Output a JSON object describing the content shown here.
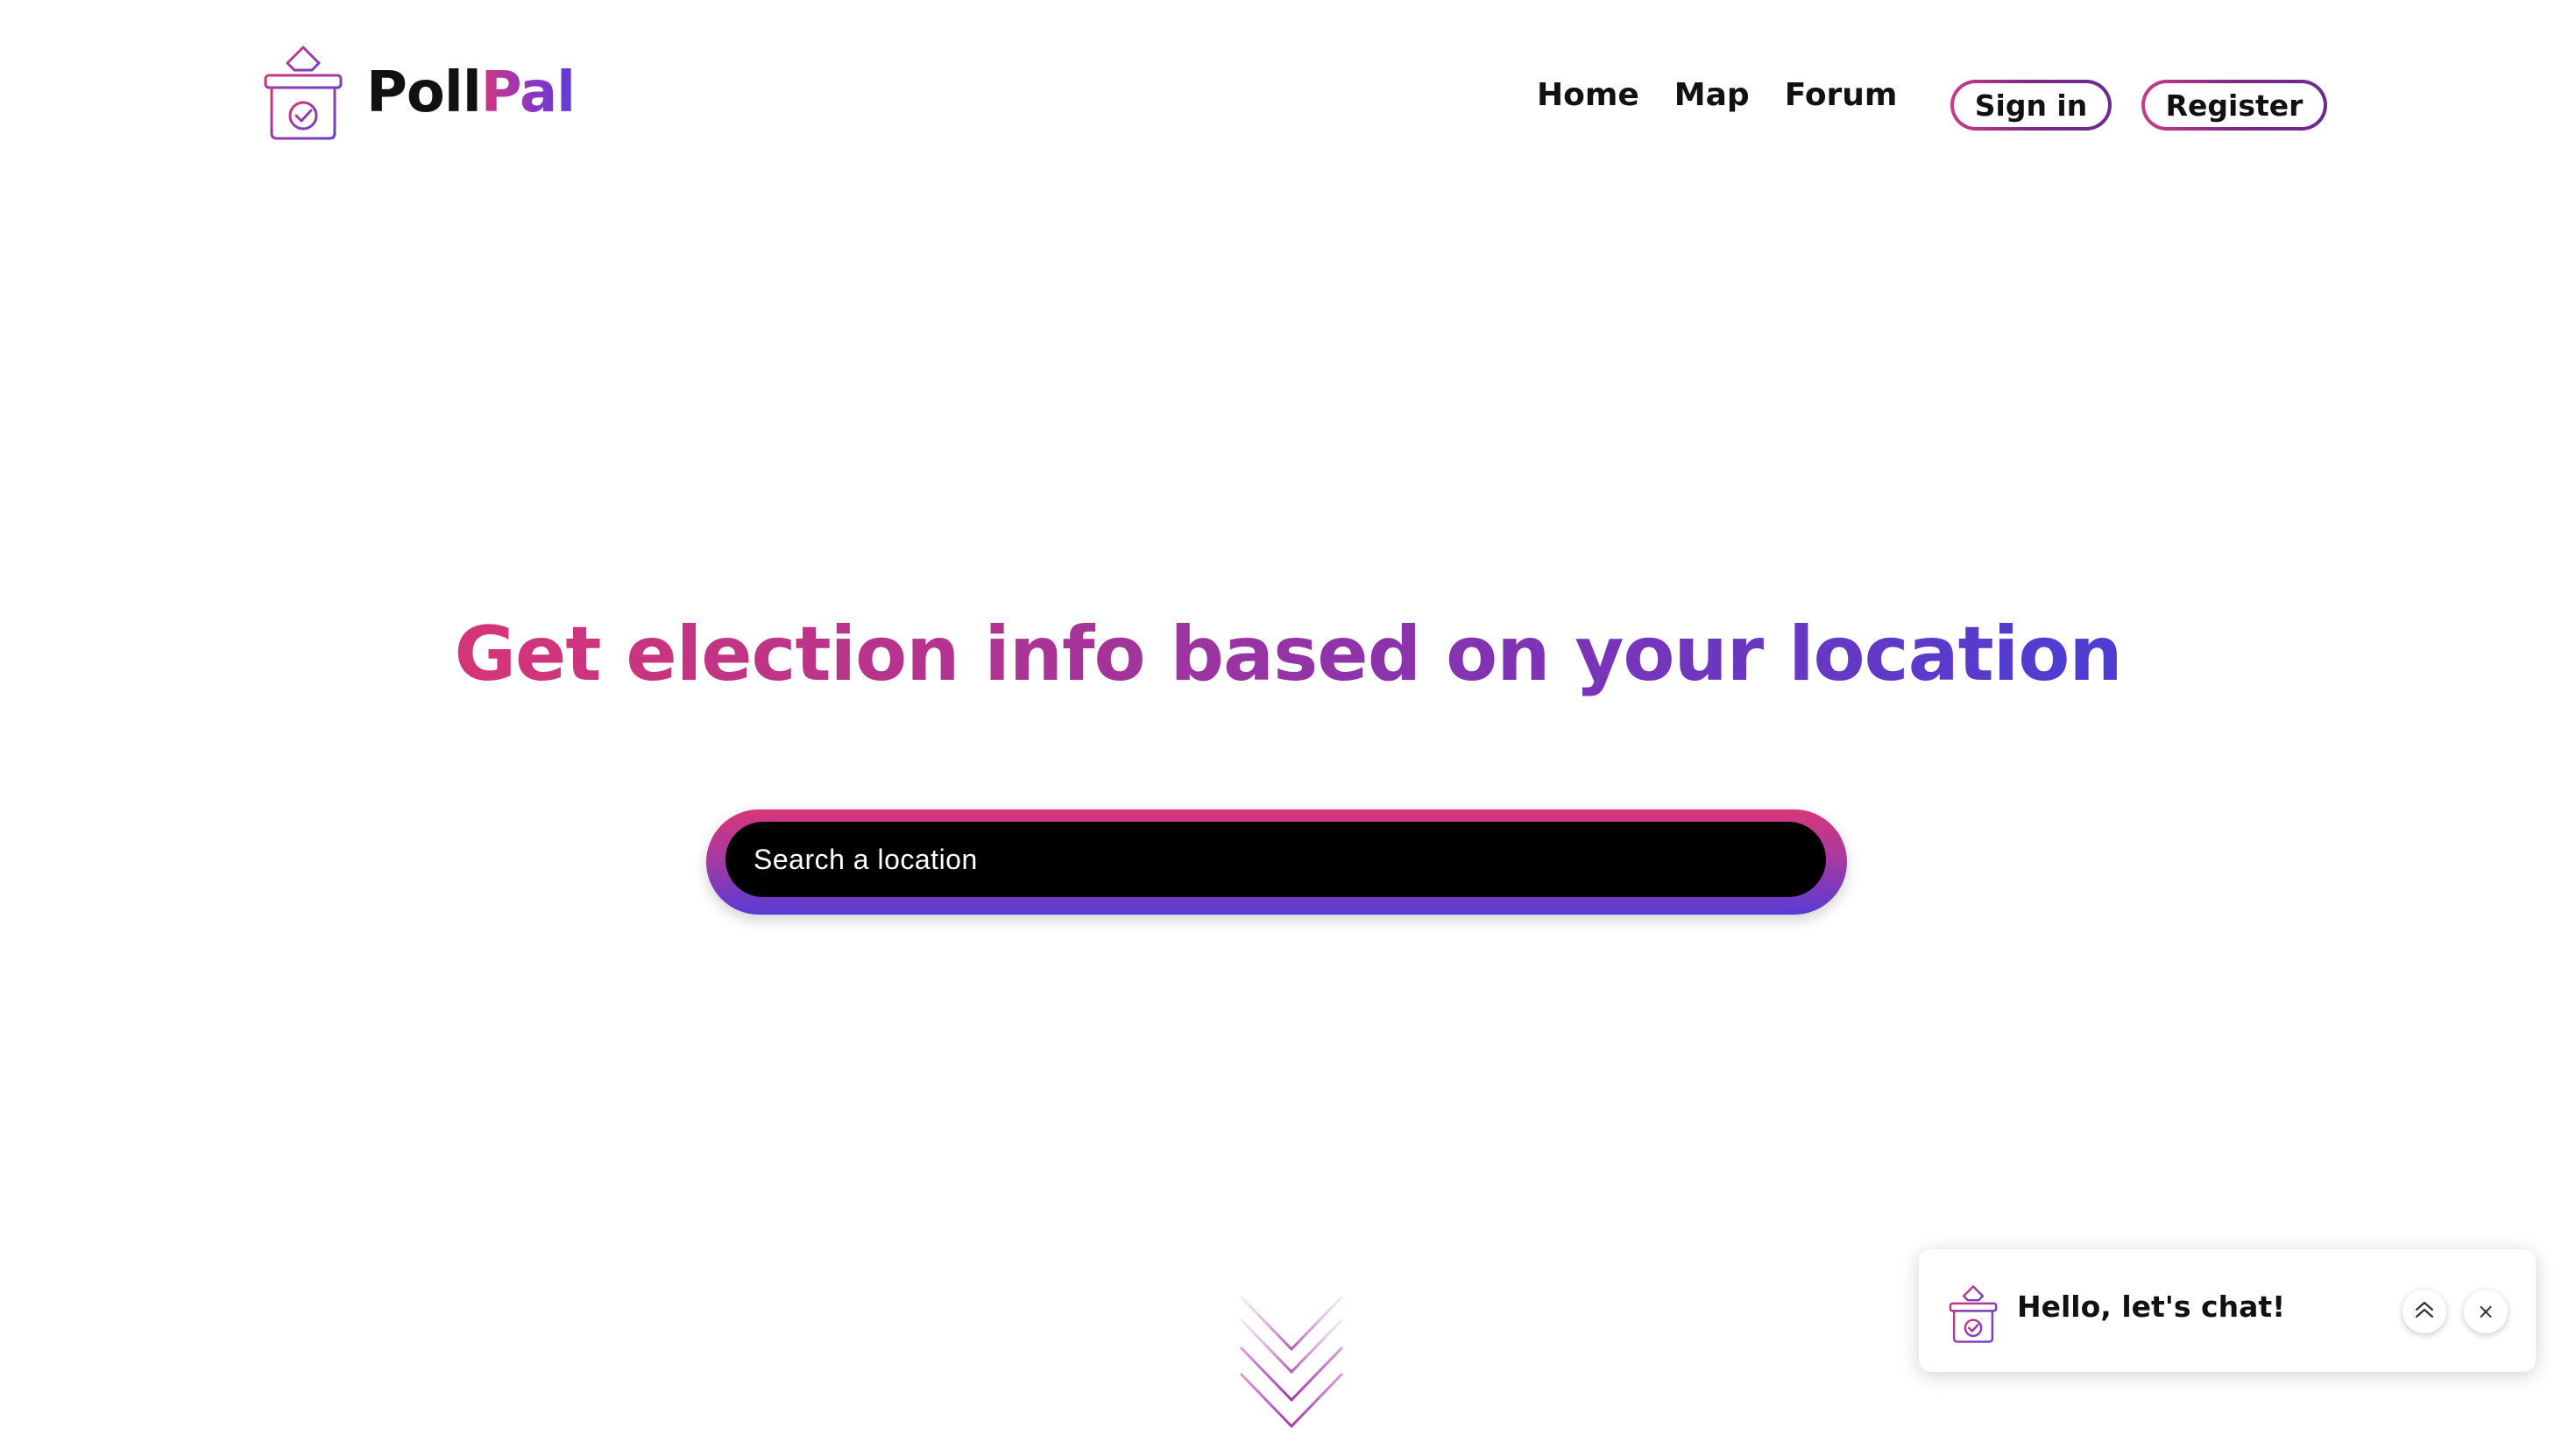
{
  "header": {
    "logo": {
      "text_part1": "Poll",
      "text_part2": "Pal",
      "icon": "ballot-box-icon"
    },
    "nav": [
      {
        "label": "Home"
      },
      {
        "label": "Map"
      },
      {
        "label": "Forum"
      }
    ],
    "signin_label": "Sign in",
    "register_label": "Register"
  },
  "hero": {
    "title": "Get election info based on your location",
    "search": {
      "placeholder": "Search a location",
      "value": ""
    }
  },
  "scroll_indicator": {
    "icon": "double-chevron-down-icon"
  },
  "chat": {
    "title": "Hello, let's chat!",
    "icon": "ballot-box-icon",
    "expand_icon": "double-chevron-up-icon",
    "close_icon": "close-icon",
    "close_glyph": "×"
  },
  "colors": {
    "accent_pink": "#d53577",
    "accent_purple": "#7e33b6",
    "accent_blue": "#4b3ed4",
    "search_field": "#000000"
  }
}
